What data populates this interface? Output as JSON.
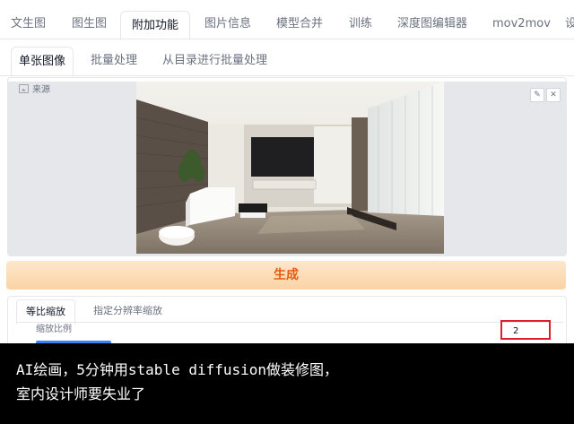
{
  "top_tabs": [
    "文生图",
    "图生图",
    "附加功能",
    "图片信息",
    "模型合并",
    "训练",
    "深度图编辑器",
    "mov2mov",
    "设"
  ],
  "active_top_tab": "附加功能",
  "sub_tabs": [
    "单张图像",
    "批量处理",
    "从目录进行批量处理"
  ],
  "source_label": "来源",
  "image_buttons": {
    "edit": "✎",
    "close": "✕"
  },
  "generate_label": "生成",
  "scale_tabs": [
    "等比缩放",
    "指定分辨率缩放"
  ],
  "ratio_label": "缩放比例",
  "ratio_value": "2",
  "caption": {
    "line1": "AI绘画，5分钟用stable diffusion做装修图，",
    "line2": "室内设计师要失业了"
  },
  "colors": {
    "generate_text": "#ea580c",
    "highlight_box": "#e11d2d",
    "slider": "#3b82f6"
  }
}
